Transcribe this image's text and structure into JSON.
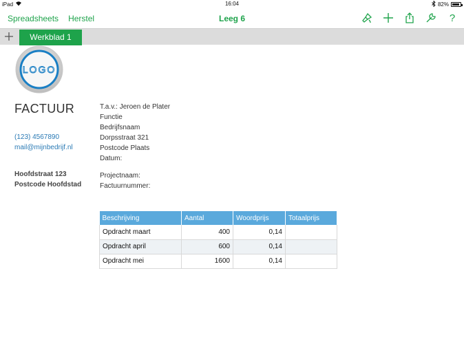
{
  "status_bar": {
    "device": "iPad",
    "time": "16:04",
    "battery": "82%",
    "battery_level": 0.82
  },
  "toolbar": {
    "spreadsheets_label": "Spreadsheets",
    "undo_label": "Herstel",
    "title": "Leeg 6",
    "icons": [
      "brush-icon",
      "plus-icon",
      "share-icon",
      "wrench-icon",
      "help-icon"
    ],
    "help_glyph": "?"
  },
  "tabs": {
    "add_glyph": "+",
    "active_tab": "Werkblad 1"
  },
  "logo": {
    "text": "LOGO"
  },
  "invoice": {
    "heading": "FACTUUR",
    "phone": "(123) 4567890",
    "email": "mail@mijnbedrijf.nl",
    "street": "Hoofdstraat 123",
    "postal": "Postcode Hoofdstad"
  },
  "recipient": {
    "attn": "T.a.v.: Jeroen de Plater",
    "function": "Functie",
    "company": "Bedrijfsnaam",
    "street": "Dorpsstraat 321",
    "postal": "Postcode Plaats",
    "date": "Datum:",
    "project": "Projectnaam:",
    "invoice_number": "Factuurnummer:"
  },
  "table": {
    "headers": [
      "Beschrijving",
      "Aantal",
      "Woordprijs",
      "Totaalprijs"
    ],
    "rows": [
      [
        "Opdracht maart",
        "400",
        "0,14",
        ""
      ],
      [
        "Opdracht april",
        "600",
        "0,14",
        ""
      ],
      [
        "Opdracht mei",
        "1600",
        "0,14",
        ""
      ]
    ]
  },
  "colors": {
    "accent": "#1ea34b",
    "header_blue": "#5aa9dc",
    "link_blue": "#2a7ab5"
  }
}
